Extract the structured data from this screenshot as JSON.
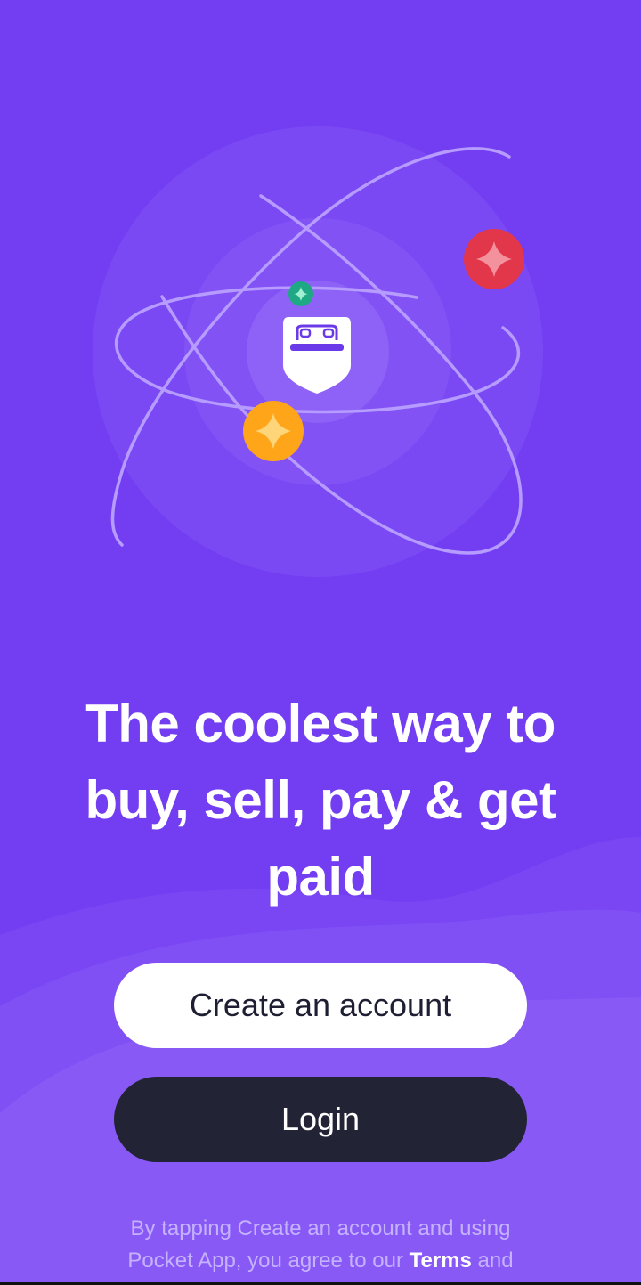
{
  "app": {
    "name": "Pocket App"
  },
  "hero": {
    "logo_icon": "pocket-helmet-icon",
    "coins": [
      {
        "name": "red-sparkle-coin-icon",
        "color": "#e2364a"
      },
      {
        "name": "yellow-sparkle-coin-icon",
        "color": "#ffa51a"
      },
      {
        "name": "green-sparkle-coin-icon",
        "color": "#1ea883"
      }
    ]
  },
  "headline": "The coolest way to buy, sell, pay & get paid",
  "buttons": {
    "create_account": "Create an account",
    "login": "Login"
  },
  "legal": {
    "line1": "By tapping Create an account and using",
    "line2_prefix": "Pocket App, you agree to our ",
    "terms_link": "Terms",
    "line2_suffix": " and"
  },
  "colors": {
    "background": "#733ef2",
    "primary_button": "#ffffff",
    "secondary_button": "#222334",
    "legal_text": "#c5b2ff"
  }
}
